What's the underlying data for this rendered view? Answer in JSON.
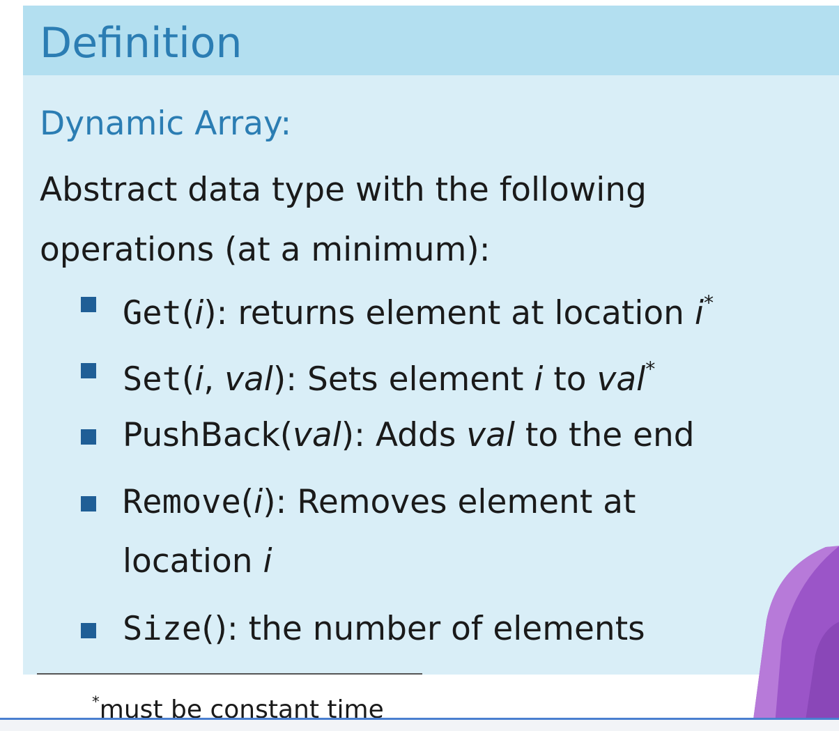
{
  "slide": {
    "block_title": "Definition",
    "term": "Dynamic Array:",
    "description_lines": [
      "Abstract data type with the following",
      "operations (at a minimum):"
    ],
    "operations": [
      {
        "name": "Get",
        "args": "i",
        "desc_1": ": returns element at location ",
        "desc_2": "i",
        "mark": "*"
      },
      {
        "name": "Set",
        "args_1": "i",
        "args_sep": ", ",
        "args_2": "val",
        "desc_1": ": Sets element ",
        "desc_2": "i",
        "desc_3": " to ",
        "desc_4": "val",
        "mark": "*"
      },
      {
        "name": "PushBack",
        "args": "val",
        "desc_1": ": Adds ",
        "desc_2": "val",
        "desc_3": " to the end"
      },
      {
        "name": "Remove",
        "args": "i",
        "desc_1": ": Removes element at",
        "desc_2": "location ",
        "desc_3": "i"
      },
      {
        "name": "Size",
        "args": "",
        "desc_1": ": the number of elements"
      }
    ],
    "footnote_mark": "*",
    "footnote_text": "must be constant time"
  },
  "colors": {
    "header_bg": "#b3dff0",
    "block_bg": "#d9eef7",
    "title": "#2b7db3",
    "bullet": "#1f5e96",
    "presenter_shirt": "#9b55c8"
  }
}
